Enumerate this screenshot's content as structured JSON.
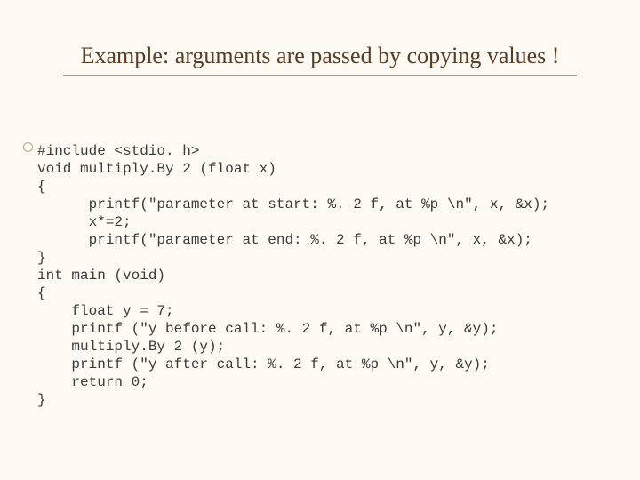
{
  "slide": {
    "title": "Example: arguments are passed by copying values !",
    "code": "#include <stdio. h>\nvoid multiply.By 2 (float x)\n{\n      printf(\"parameter at start: %. 2 f, at %p \\n\", x, &x);\n      x*=2;\n      printf(\"parameter at end: %. 2 f, at %p \\n\", x, &x);\n}\nint main (void)\n{\n    float y = 7;\n    printf (\"y before call: %. 2 f, at %p \\n\", y, &y);\n    multiply.By 2 (y);\n    printf (\"y after call: %. 2 f, at %p \\n\", y, &y);\n    return 0;\n}"
  }
}
